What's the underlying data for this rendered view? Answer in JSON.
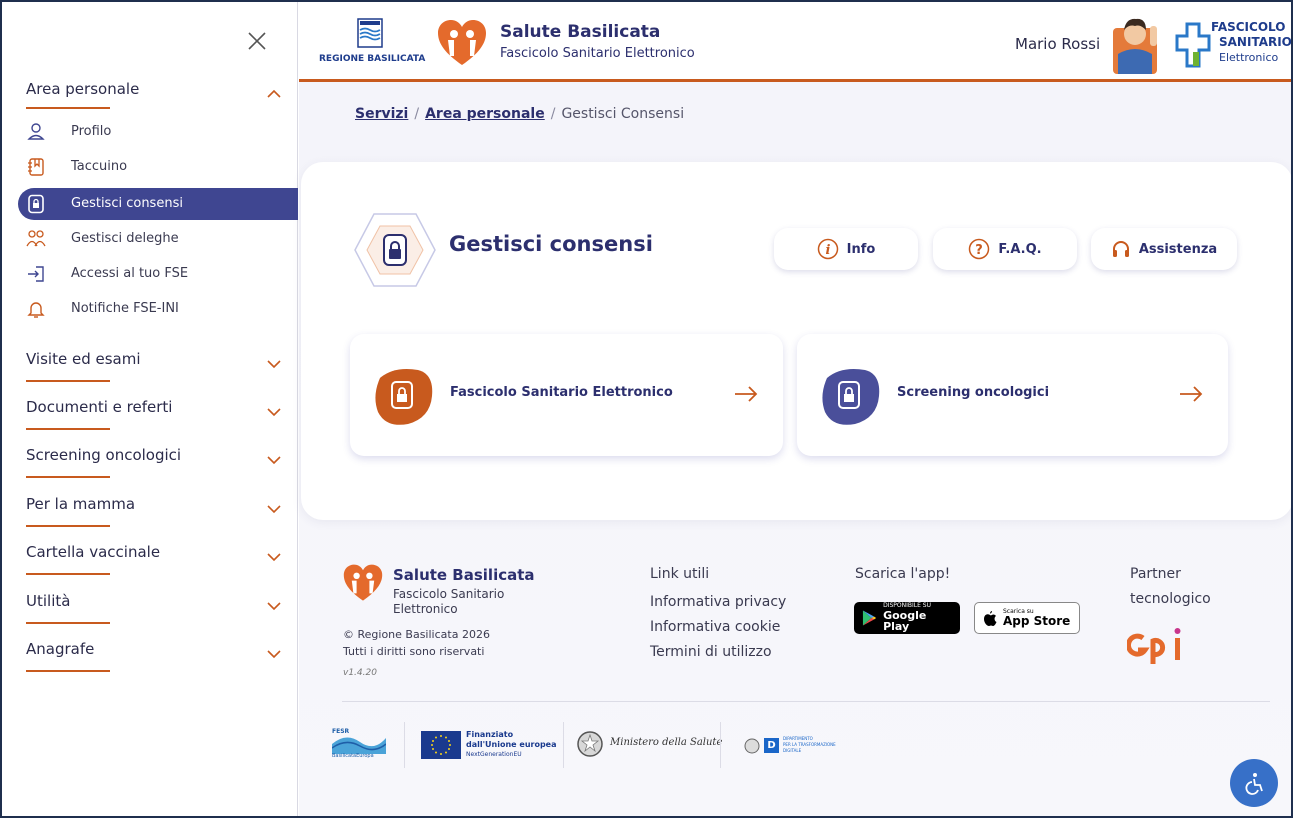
{
  "header": {
    "region_label": "REGIONE BASILICATA",
    "brand_title": "Salute Basilicata",
    "brand_subtitle": "Fascicolo Sanitario Elettronico",
    "user_name": "Mario Rossi",
    "fse_logo_lines": [
      "FASCICOLO",
      "SANITARIO",
      "Elettronico"
    ]
  },
  "sidebar": {
    "sections": [
      {
        "label": "Area personale",
        "expanded": true
      },
      {
        "label": "Visite ed esami",
        "expanded": false
      },
      {
        "label": "Documenti e referti",
        "expanded": false
      },
      {
        "label": "Screening oncologici",
        "expanded": false
      },
      {
        "label": "Per la mamma",
        "expanded": false
      },
      {
        "label": "Cartella vaccinale",
        "expanded": false
      },
      {
        "label": "Utilità",
        "expanded": false
      },
      {
        "label": "Anagrafe",
        "expanded": false
      }
    ],
    "items": [
      {
        "label": "Profilo",
        "icon": "user-icon"
      },
      {
        "label": "Taccuino",
        "icon": "notebook-icon"
      },
      {
        "label": "Gestisci consensi",
        "icon": "lock-document-icon",
        "active": true
      },
      {
        "label": "Gestisci deleghe",
        "icon": "users-icon"
      },
      {
        "label": "Accessi al tuo FSE",
        "icon": "login-icon"
      },
      {
        "label": "Notifiche FSE-INI",
        "icon": "bell-icon"
      }
    ]
  },
  "breadcrumb": {
    "items": [
      "Servizi",
      "Area personale"
    ],
    "current": "Gestisci Consensi"
  },
  "main": {
    "title": "Gestisci consensi",
    "actions": [
      {
        "label": "Info",
        "icon": "info-icon"
      },
      {
        "label": "F.A.Q.",
        "icon": "question-icon"
      },
      {
        "label": "Assistenza",
        "icon": "headset-icon"
      }
    ],
    "tiles": [
      {
        "label": "Fascicolo Sanitario Elettronico",
        "color": "#c85a1e"
      },
      {
        "label": "Screening oncologici",
        "color": "#4a4f9a"
      }
    ]
  },
  "footer": {
    "brand_title": "Salute Basilicata",
    "brand_subtitle_1": "Fascicolo Sanitario",
    "brand_subtitle_2": "Elettronico",
    "copyright": "© Regione Basilicata 2026",
    "rights": "Tutti i diritti sono riservati",
    "version": "v1.4.20",
    "links_title": "Link utili",
    "links": [
      "Informativa privacy",
      "Informativa cookie",
      "Termini di utilizzo"
    ],
    "app_title": "Scarica l'app!",
    "google_small": "DISPONIBILE SU",
    "google_big": "Google Play",
    "apple_small": "Scarica su",
    "apple_big": "App Store",
    "partner_title_1": "Partner",
    "partner_title_2": "tecnologico",
    "partner_logo": "GPI",
    "funding": {
      "fesr": "FESR",
      "fesr_sub": "BasilicataEuropa",
      "eu_1": "Finanziato",
      "eu_2": "dall'Unione europea",
      "eu_3": "NextGenerationEU",
      "ministero": "Ministero della Salute",
      "dip_1": "DIPARTIMENTO",
      "dip_2": "PER LA TRASFORMAZIONE",
      "dip_3": "DIGITALE"
    }
  },
  "colors": {
    "accent_orange": "#c85a1e",
    "primary_navy": "#2c2f6e",
    "active_bg": "#3f4691",
    "accessibility_blue": "#3770c8"
  }
}
